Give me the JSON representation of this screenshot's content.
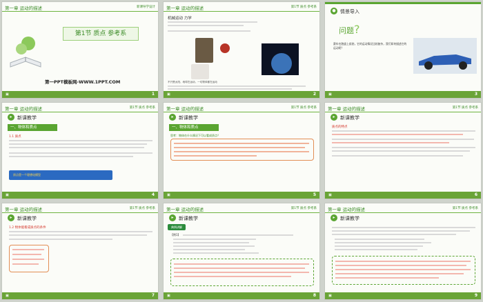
{
  "header": {
    "chapter": "第一章 运动的描述",
    "right_a": "新课导学设计",
    "right_b": "第1节 质点 参考系"
  },
  "footer_icon": "book-icon",
  "slides": [
    {
      "page": "1",
      "title": "第1节 质点 参考系",
      "site": "第一PPT模板网-WWW.1PPT.COM"
    },
    {
      "page": "2",
      "heading": "机械运动 力学",
      "small_text": "不只是太阳、地球在运动，一切物体都在运动"
    },
    {
      "page": "3",
      "title": "情景导入",
      "q": "问题",
      "body": "赛车在跑道上疾驰，它的运动情况比较复杂，我们如何描述它的运动呢？"
    },
    {
      "page": "4",
      "sec": "新课教学",
      "bar": "一、物体和质点",
      "sub": "1.1 质点",
      "note": "质点是一个理想化模型"
    },
    {
      "page": "5",
      "sec": "新课教学",
      "bar": "一、物体和质点",
      "q": "思考：物体在什么情况下可以看成质点？"
    },
    {
      "page": "6",
      "sec": "新课教学",
      "sub": "质点的特点"
    },
    {
      "page": "7",
      "sec": "新课教学",
      "sub": "1.2 物体能看成质点的条件"
    },
    {
      "page": "8",
      "sec": "新课教学",
      "badge": "典例讲解",
      "sub": "【例1】"
    },
    {
      "page": "9",
      "sec": "新课教学"
    }
  ]
}
